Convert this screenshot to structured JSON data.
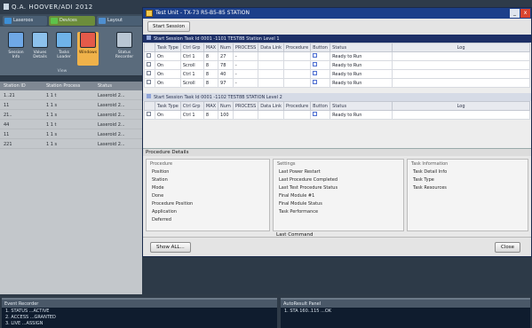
{
  "app": {
    "title": "Q.A. HOOVER/ADI 2012",
    "ribbon_tabs": [
      {
        "label": "Laseroos",
        "icon": "blue-square-icon"
      },
      {
        "label": "Devices",
        "icon": "green-device-icon"
      },
      {
        "label": "Layout",
        "icon": "blue-layout-icon"
      }
    ],
    "ribbon_buttons": [
      {
        "label": "Session Info"
      },
      {
        "label": "Values Details"
      },
      {
        "label": "Tasks Loader"
      },
      {
        "label": "Windows"
      },
      {
        "label": "Status Recorder"
      }
    ],
    "ribbon_group_label": "View",
    "grid": {
      "columns": [
        "Station ID",
        "Station Process",
        "Status"
      ],
      "rows": [
        [
          "1..21",
          "1 1 t",
          "Laseroid 2..."
        ],
        [
          "11",
          "1 1 s",
          "Laseroid 2..."
        ],
        [
          "21..",
          "1 1 s",
          "Laseroid 2..."
        ],
        [
          "44",
          "1 1 t",
          "Laseroid 2..."
        ],
        [
          "11",
          "1 1 s",
          "Laseroid 2..."
        ],
        [
          "221",
          "1 1 s",
          "Laseroid 2..."
        ]
      ]
    },
    "bottom_panels": [
      {
        "title": "Event Recorder",
        "lines": [
          "1. STATUS ...ACTIVE",
          "2. ACCESS ...GRANTED",
          "3. LIVE ...ASSIGN"
        ]
      },
      {
        "title": "AutoResult Panel",
        "lines": [
          "1. STA 160..115 ...OK"
        ]
      }
    ]
  },
  "dialog": {
    "title": "Test Unit - TX-73 R5-B5-85 STATION",
    "minimize_label": "_",
    "close_label": "x",
    "toolbar": {
      "start_session_label": "Start Session"
    },
    "section1": {
      "band": "Start Session Task Id 0001 -1101 TEST8B Station Level 1",
      "columns": [
        "",
        "Task Type",
        "Ctrl Grp",
        "MAX",
        "Num",
        "PROCESS",
        "Data Link",
        "Procedure",
        "Button",
        "Status",
        "Log"
      ],
      "rows": [
        [
          "",
          "On",
          "Ctrl 1",
          "8",
          "27",
          "-",
          "",
          "",
          "",
          "Ready to Run",
          ""
        ],
        [
          "",
          "On",
          "Scroll",
          "8",
          "78",
          "-",
          "",
          "",
          "",
          "Ready to Run",
          ""
        ],
        [
          "",
          "On",
          "Ctrl 1",
          "8",
          "40",
          "-",
          "",
          "",
          "",
          "Ready to Run",
          ""
        ],
        [
          "",
          "On",
          "Scroll",
          "8",
          "97",
          "-",
          "",
          "",
          "",
          "Ready to Run",
          ""
        ]
      ]
    },
    "section2": {
      "band": "Start Session Task Id 0001 -1102 TEST8B STATION Level 2",
      "columns": [
        "",
        "Task Type",
        "Ctrl Grp",
        "MAX",
        "Num",
        "PROCESS",
        "Data Link",
        "Procedure",
        "Button",
        "Status",
        "Log"
      ],
      "rows": [
        [
          "",
          "On",
          "Ctrl 1",
          "8",
          "100",
          "",
          "",
          "",
          "",
          "Ready to Run",
          ""
        ]
      ]
    },
    "details": {
      "title": "Procedure Details",
      "group1": {
        "title": "Procedure",
        "lines": [
          "Position",
          "Station",
          "Mode",
          "Done",
          "Procedure Position",
          "Application",
          "Deferred"
        ]
      },
      "group2": {
        "title": "Settings",
        "lines": [
          "Last Power Restart",
          "Last Procedure Completed",
          "Last Test Procedure Status",
          "Final Module #1",
          "Final Module Status",
          "Task Performance"
        ]
      },
      "group3": {
        "title": "Task Information",
        "lines": [
          "Task Detail Info",
          "Task Type",
          "Task Resources"
        ]
      },
      "last_command_label": "Last Command"
    },
    "footer": {
      "show_all_label": "Show ALL...",
      "close_label": "Close"
    }
  }
}
